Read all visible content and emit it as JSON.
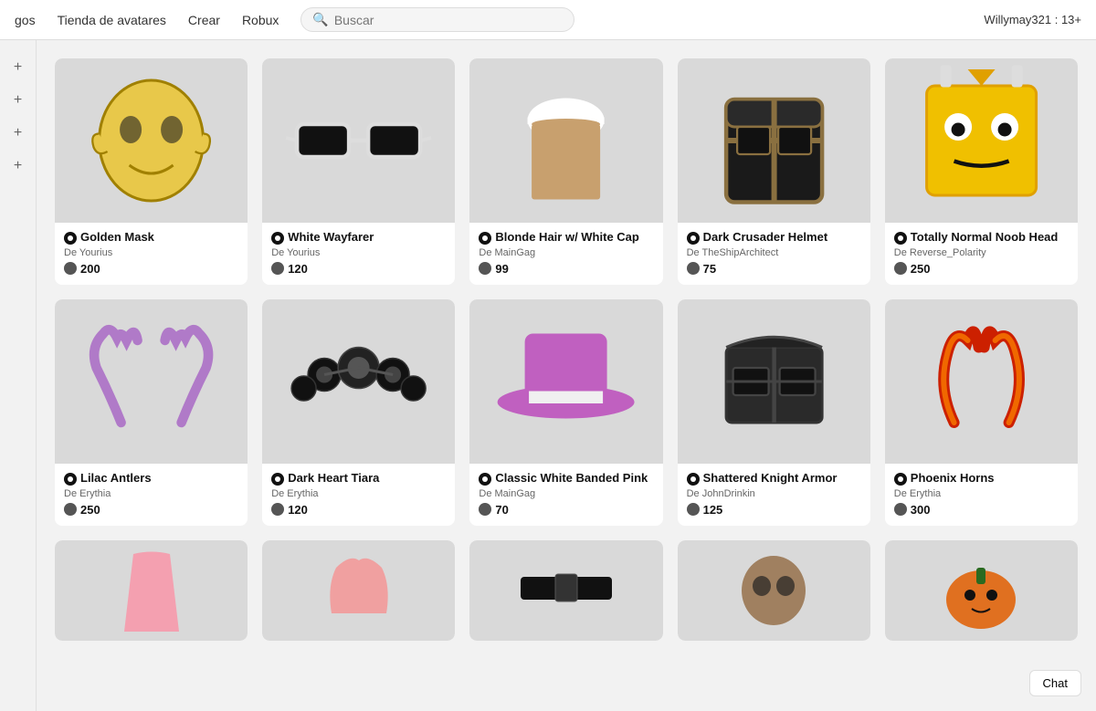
{
  "navbar": {
    "nav_items": [
      "gos",
      "Tienda de avatares",
      "Crear",
      "Robux"
    ],
    "search_placeholder": "Buscar",
    "user_label": "Willymay321 : 13+"
  },
  "items": [
    {
      "id": "golden-mask",
      "name": "Golden Mask",
      "creator_prefix": "De",
      "creator": "Yourius",
      "price": "200",
      "color": "#e8c84a",
      "shape": "mask"
    },
    {
      "id": "white-wayfarer",
      "name": "White Wayfarer",
      "creator_prefix": "De",
      "creator": "Yourius",
      "price": "120",
      "color": "#ccc",
      "shape": "glasses"
    },
    {
      "id": "blonde-hair",
      "name": "Blonde Hair w/ White Cap",
      "creator_prefix": "De",
      "creator": "MainGag",
      "price": "99",
      "color": "#c8a06e",
      "shape": "hair"
    },
    {
      "id": "dark-crusader",
      "name": "Dark Crusader Helmet",
      "creator_prefix": "De",
      "creator": "TheShipArchitect",
      "price": "75",
      "color": "#2a2a2a",
      "shape": "helmet"
    },
    {
      "id": "noob-head",
      "name": "Totally Normal Noob Head",
      "creator_prefix": "De",
      "creator": "Reverse_Polarity",
      "price": "250",
      "color": "#f0c000",
      "shape": "noob"
    },
    {
      "id": "lilac-antlers",
      "name": "Lilac Antlers",
      "creator_prefix": "De",
      "creator": "Erythia",
      "price": "250",
      "color": "#b07ac8",
      "shape": "antlers"
    },
    {
      "id": "dark-heart-tiara",
      "name": "Dark Heart Tiara",
      "creator_prefix": "De",
      "creator": "Erythia",
      "price": "120",
      "color": "#222",
      "shape": "tiara"
    },
    {
      "id": "classic-white-banded",
      "name": "Classic White Banded Pink",
      "creator_prefix": "De",
      "creator": "MainGag",
      "price": "70",
      "color": "#c060c0",
      "shape": "hat"
    },
    {
      "id": "shattered-knight",
      "name": "Shattered Knight Armor",
      "creator_prefix": "De",
      "creator": "JohnDrinkin",
      "price": "125",
      "color": "#333",
      "shape": "armor"
    },
    {
      "id": "phoenix-horns",
      "name": "Phoenix Horns",
      "creator_prefix": "De",
      "creator": "Erythia",
      "price": "300",
      "color": "#e05020",
      "shape": "horns"
    }
  ],
  "partial_items": [
    {
      "id": "pink-outfit",
      "color": "#f4a0b0",
      "shape": "outfit"
    },
    {
      "id": "pink-hair2",
      "color": "#f0a0a0",
      "shape": "hair2"
    },
    {
      "id": "black-belt",
      "color": "#111",
      "shape": "belt"
    },
    {
      "id": "skull-helmet",
      "color": "#a08060",
      "shape": "skull"
    },
    {
      "id": "pumpkin-head",
      "color": "#e07020",
      "shape": "pumpkin"
    }
  ],
  "sidebar": {
    "icons": [
      "+",
      "+",
      "+",
      "+"
    ]
  },
  "chat_label": "Chat"
}
